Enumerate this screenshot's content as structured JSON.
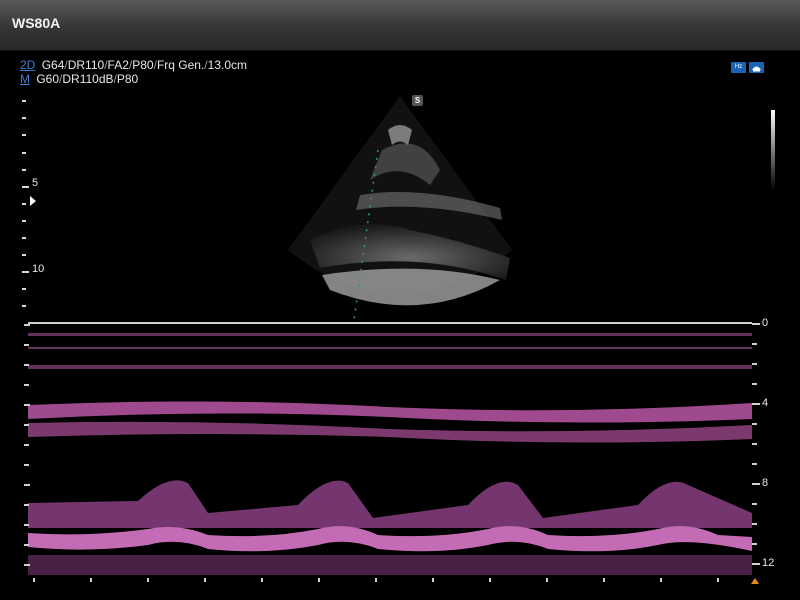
{
  "app": {
    "title": "WS80A"
  },
  "params": {
    "line_2d": {
      "mode": "2D",
      "items": [
        "G64",
        "DR110",
        "FA2",
        "P80",
        "Frq Gen.",
        "13.0cm"
      ]
    },
    "line_m": {
      "mode": "M",
      "items": [
        "G60",
        "DR110dB",
        "P80"
      ]
    }
  },
  "badges": {
    "hz_label": "Hz",
    "probe_icon": "heart-probe-icon"
  },
  "markers": {
    "s_label": "S"
  },
  "depth_scale_2d": {
    "labels": [
      "5",
      "10"
    ]
  },
  "depth_scale_m": {
    "labels": [
      "0",
      "4",
      "8",
      "12"
    ]
  },
  "colors": {
    "mmode_tint": "#b0519d",
    "accent_blue": "#3b7fd6",
    "marker_orange": "#e58a1f"
  }
}
